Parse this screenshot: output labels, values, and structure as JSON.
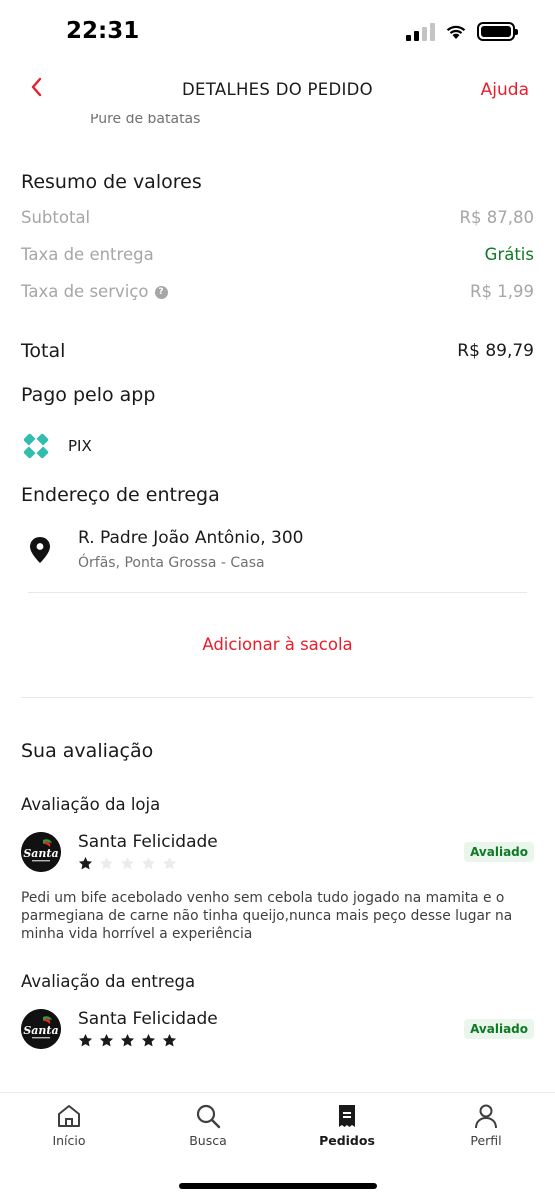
{
  "status_bar": {
    "time": "22:31"
  },
  "header": {
    "title": "DETALHES DO PEDIDO",
    "help": "Ajuda"
  },
  "cutoff_item": "Purê de batatas",
  "summary": {
    "title": "Resumo de valores",
    "subtotal_label": "Subtotal",
    "subtotal_value": "R$ 87,80",
    "delivery_label": "Taxa de entrega",
    "delivery_value": "Grátis",
    "service_label": "Taxa de serviço",
    "service_value": "R$ 1,99",
    "total_label": "Total",
    "total_value": "R$ 89,79"
  },
  "payment": {
    "title": "Pago pelo app",
    "method": "PIX"
  },
  "address": {
    "title": "Endereço de entrega",
    "line1": "R. Padre João Antônio, 300",
    "line2": "Órfãs, Ponta Grossa - Casa"
  },
  "add_to_bag": "Adicionar à sacola",
  "rating": {
    "title": "Sua avaliação",
    "store_title": "Avaliação da loja",
    "store_name": "Santa Felicidade",
    "store_badge": "Avaliado",
    "store_stars": 1,
    "store_review": "Pedi um bife acebolado venho sem cebola tudo jogado na mamita e o parmegiana de carne não tinha queijo,nunca mais peço desse lugar na minha vida horrível a experiência",
    "delivery_title": "Avaliação da entrega",
    "delivery_name": "Santa Felicidade",
    "delivery_badge": "Avaliado",
    "delivery_stars": 5,
    "logo_text": "Santa"
  },
  "nav": {
    "home": "Início",
    "search": "Busca",
    "orders": "Pedidos",
    "profile": "Perfil"
  },
  "colors": {
    "accent": "#ea1d2c",
    "green": "#0f7a26",
    "pix": "#32bcad"
  }
}
